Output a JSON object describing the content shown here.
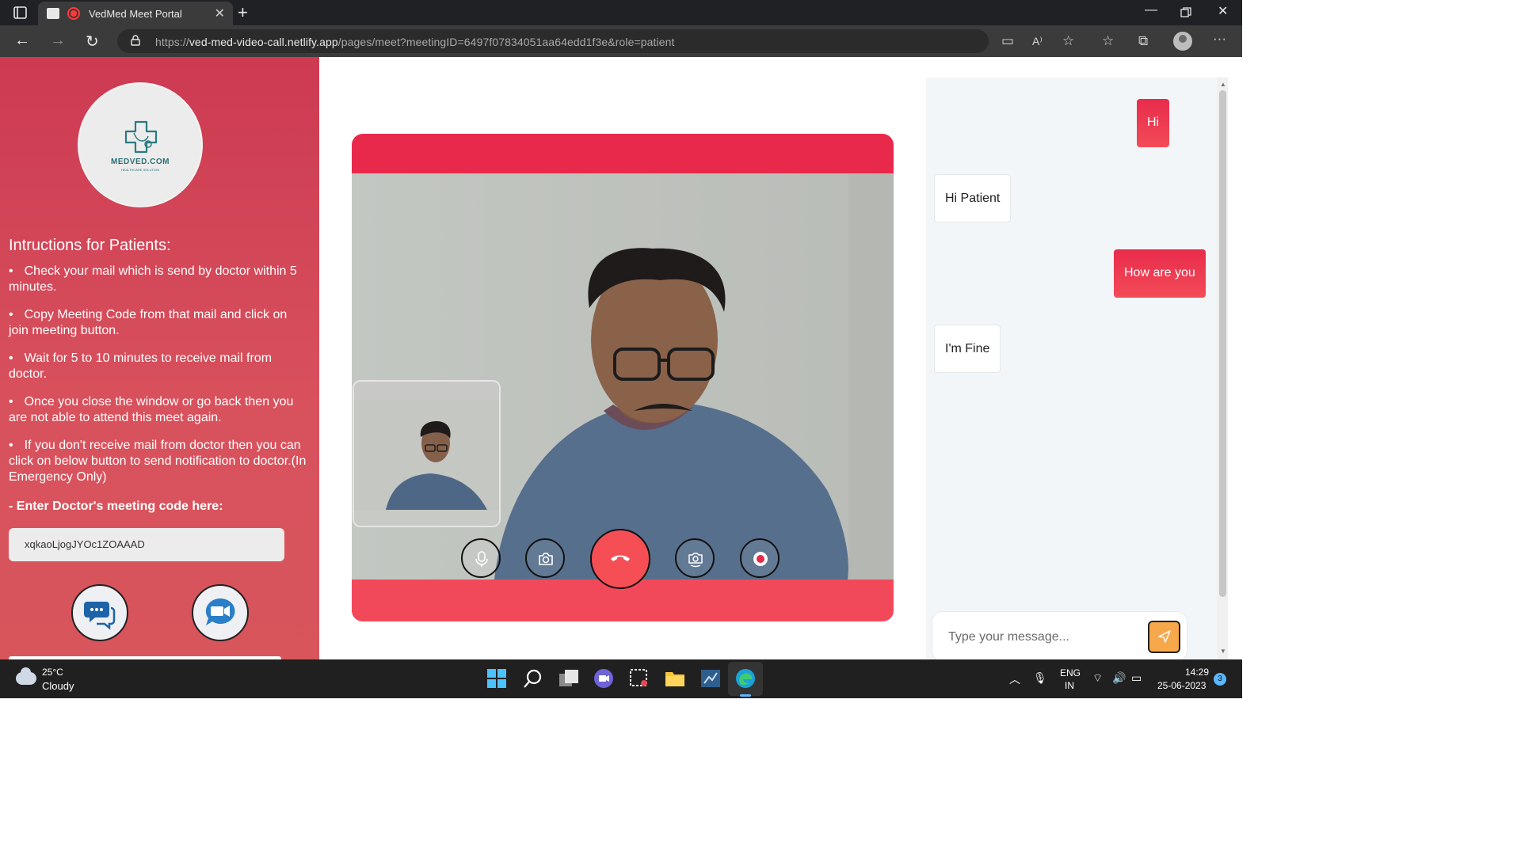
{
  "browser": {
    "tab_title": "VedMed Meet Portal",
    "url_scheme": "https://",
    "url_host": "ved-med-video-call.netlify.app",
    "url_rest": "/pages/meet?meetingID=6497f07834051aa64edd1f3e&role=patient"
  },
  "sidebar": {
    "logo_text": "MEDVED.COM",
    "logo_subtext": "HEALTHCARE SOLUTION",
    "instructions_title": "Intructions for Patients:",
    "instructions": [
      "Check your mail which is send by doctor within 5 minutes.",
      "Copy Meeting Code from that mail and click on join meeting button.",
      "Wait for 5 to 10 minutes to receive mail from doctor.",
      "Once you close the window or go back then you are not able to attend this meet again.",
      "If you don't receive mail from doctor then you can click on below button to send notification to doctor.(In Emergency Only)"
    ],
    "code_label": "- Enter Doctor's meeting code here:",
    "meeting_code": "xqkaoLjogJYOc1ZOAAAD"
  },
  "call_controls": {
    "icons": [
      "microphone-icon",
      "camera-icon",
      "phone-hangup-icon",
      "switch-camera-icon",
      "record-icon"
    ],
    "hangup_color": "#f64e55"
  },
  "chat": {
    "messages": [
      {
        "direction": "out",
        "text": "Hi"
      },
      {
        "direction": "in",
        "text": "Hi Patient"
      },
      {
        "direction": "out",
        "text": "How are you"
      },
      {
        "direction": "in",
        "text": "I'm Fine"
      }
    ],
    "input_placeholder": "Type your message...",
    "send_button_color": "#f7a84a"
  },
  "colors": {
    "sidebar": "#d04557",
    "accent": "#e8294b",
    "video_band_bottom": "#f2495a"
  },
  "taskbar": {
    "weather_temp": "25°C",
    "weather_desc": "Cloudy",
    "lang_line1": "ENG",
    "lang_line2": "IN",
    "time": "14:29",
    "date": "25-06-2023",
    "notification_count": "3"
  }
}
